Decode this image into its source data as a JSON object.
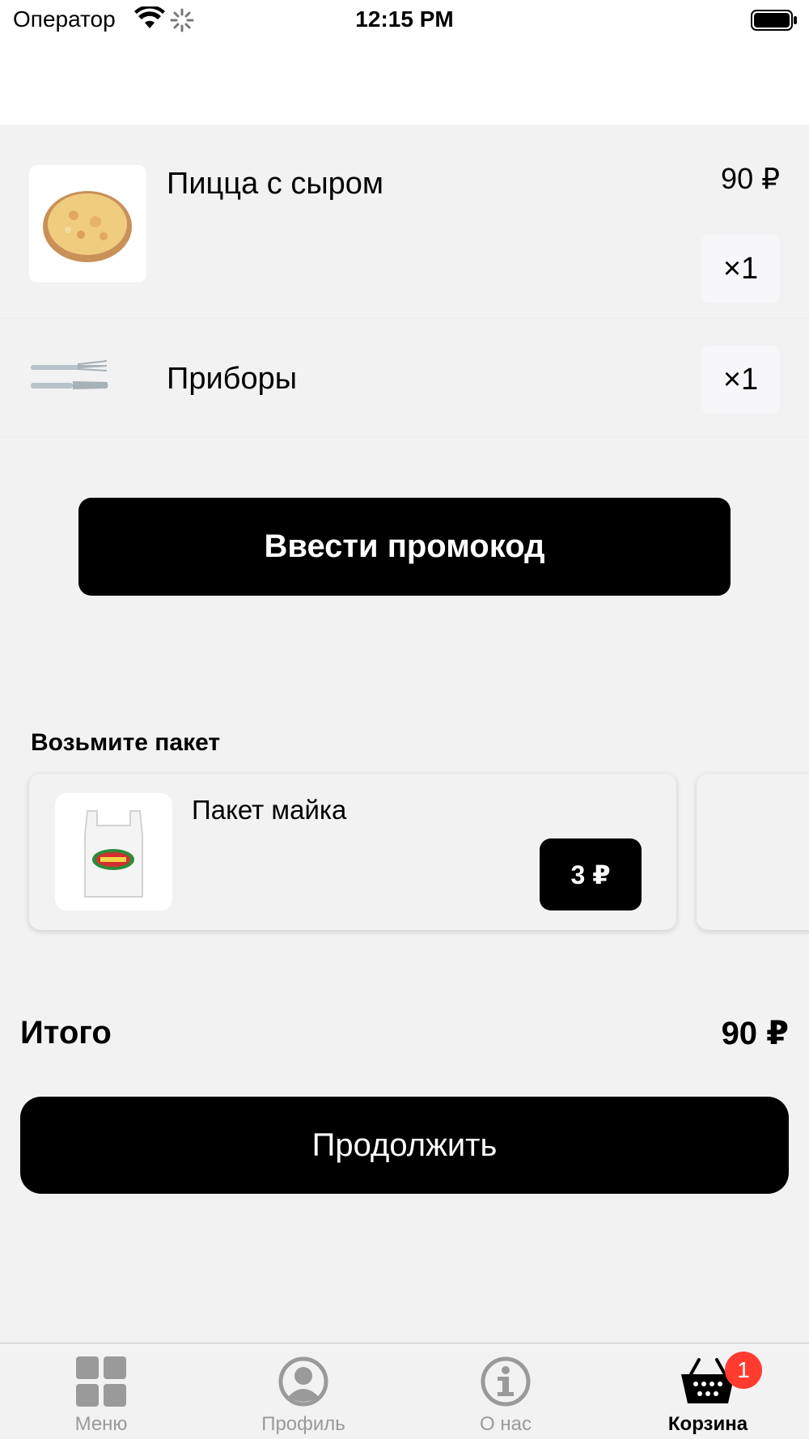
{
  "status_bar": {
    "carrier": "Оператор",
    "time": "12:15 PM"
  },
  "cart": {
    "items": [
      {
        "name": "Пицца с сыром",
        "price": "90 ₽",
        "quantity": "×1",
        "icon": "pizza-image"
      },
      {
        "name": "Приборы",
        "quantity": "×1",
        "icon": "cutlery-icon"
      }
    ],
    "promo_button": "Ввести промокод"
  },
  "bag_section": {
    "heading": "Возьмите пакет",
    "product": {
      "name": "Пакет майка",
      "price": "3 ₽",
      "icon": "plastic-bag-image"
    }
  },
  "total": {
    "label": "Итого",
    "value": "90 ₽"
  },
  "continue_button": "Продолжить",
  "tab_bar": {
    "tabs": [
      {
        "label": "Меню",
        "icon": "grid-icon"
      },
      {
        "label": "Профиль",
        "icon": "profile-icon"
      },
      {
        "label": "О нас",
        "icon": "info-icon"
      },
      {
        "label": "Корзина",
        "icon": "basket-icon",
        "badge": "1",
        "active": true
      }
    ]
  },
  "colors": {
    "background": "#f2f2f2",
    "button": "#000000",
    "badge": "#ff3b30",
    "inactive_tab": "#9a9a9a"
  }
}
